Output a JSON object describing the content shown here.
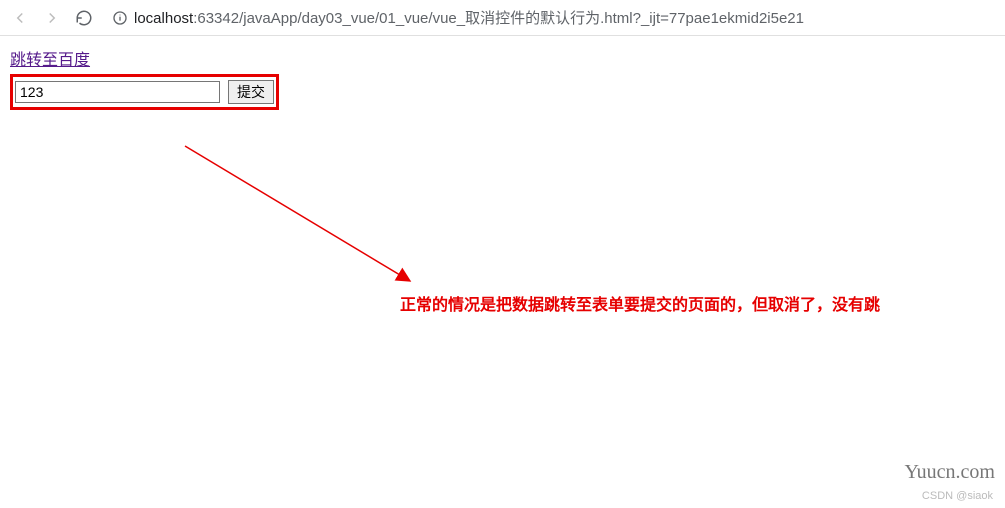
{
  "url": {
    "host": "localhost",
    "path": ":63342/javaApp/day03_vue/01_vue/vue_取消控件的默认行为.html?_ijt=77pae1ekmid2i5e21"
  },
  "page": {
    "link_text": "跳转至百度",
    "input_value": "123",
    "submit_label": "提交"
  },
  "annotation": {
    "text": "正常的情况是把数据跳转至表单要提交的页面的，但取消了，没有跳",
    "color": "#e60000"
  },
  "watermark": {
    "site": "Yuucn.com",
    "credit": "CSDN @siaok"
  }
}
